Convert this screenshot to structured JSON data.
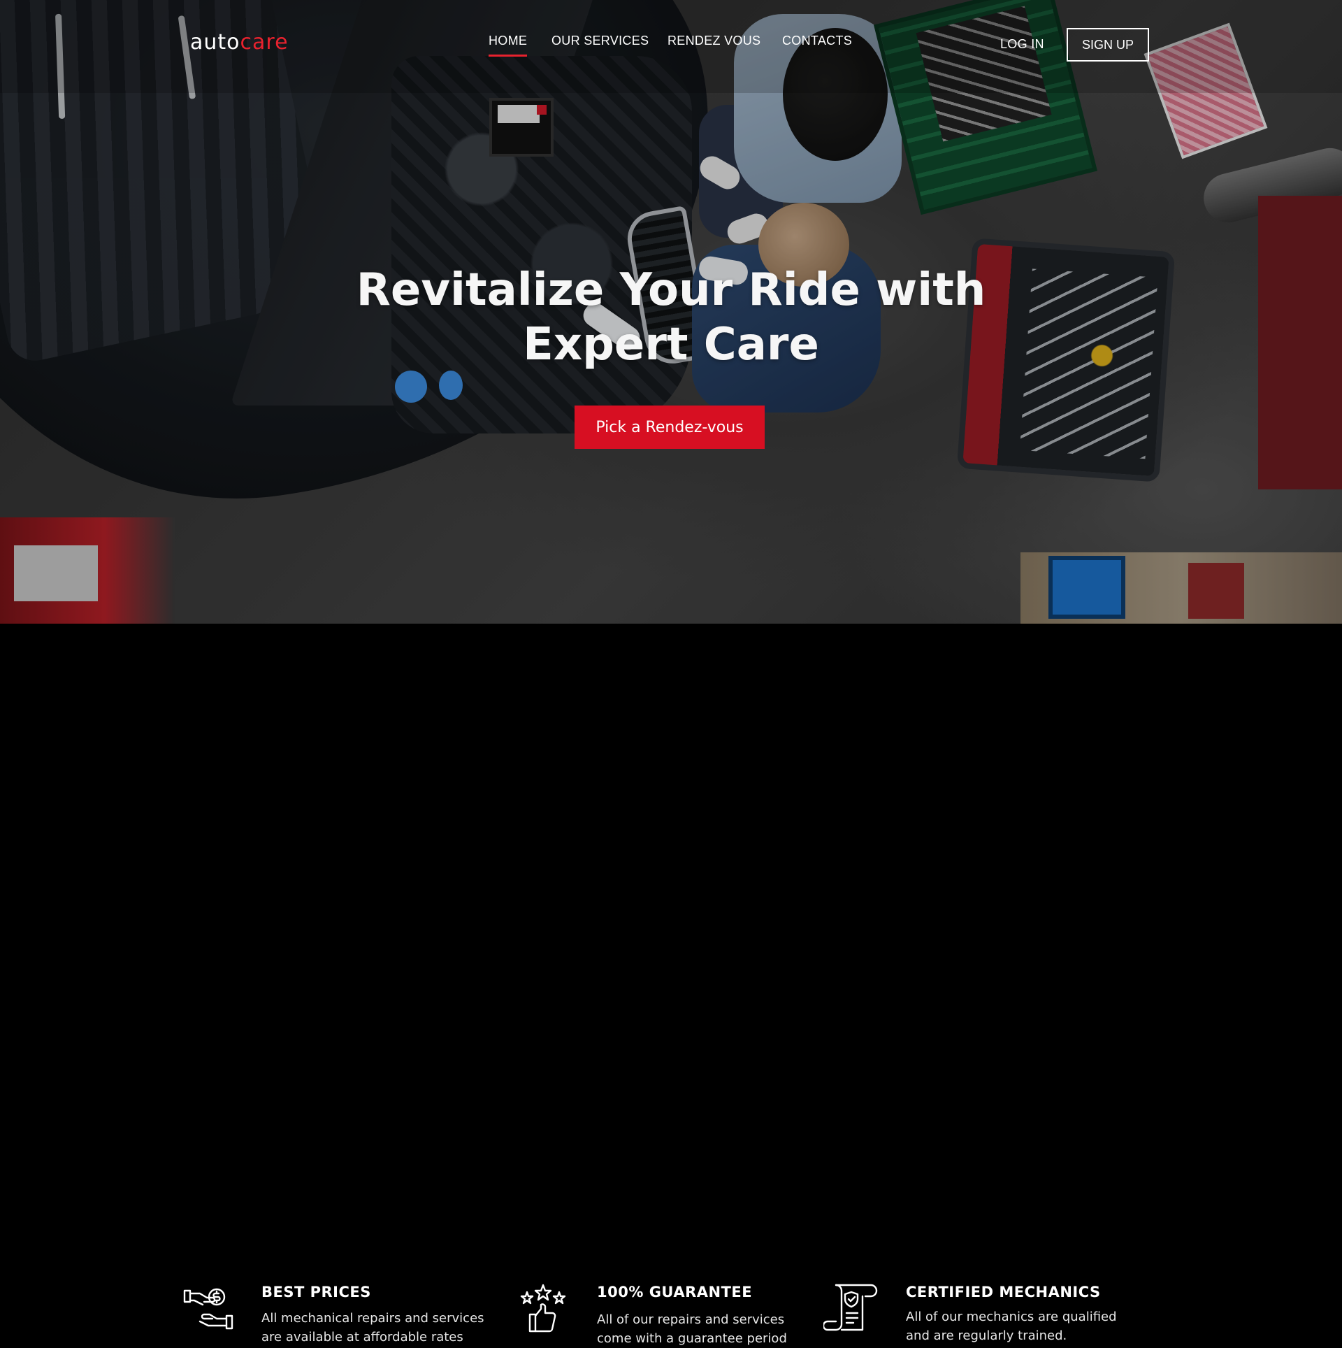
{
  "brand": {
    "logo_prefix": "auto",
    "logo_accent": "care",
    "accent_color": "#e8222e",
    "cta_color": "#d70f22"
  },
  "nav": {
    "home": "HOME",
    "services": "OUR SERVICES",
    "rendezvous": "RENDEZ VOUS",
    "contacts": "CONTACTS",
    "login": "LOG IN",
    "signup": "SIGN UP"
  },
  "hero": {
    "headline": "Revitalize Your Ride with Expert Care",
    "cta": "Pick a Rendez-vous"
  },
  "features": [
    {
      "icon": "hand-coin-icon",
      "title": "BEST PRICES",
      "text": "All mechanical repairs and services are available at affordable rates"
    },
    {
      "icon": "thumbs-up-stars-icon",
      "title": "100% GUARANTEE",
      "text": "All of our repairs and services come with a guarantee period"
    },
    {
      "icon": "certificate-shield-icon",
      "title": "CERTIFIED MECHANICS",
      "text": "All of our mechanics are qualified and are regularly trained."
    }
  ]
}
